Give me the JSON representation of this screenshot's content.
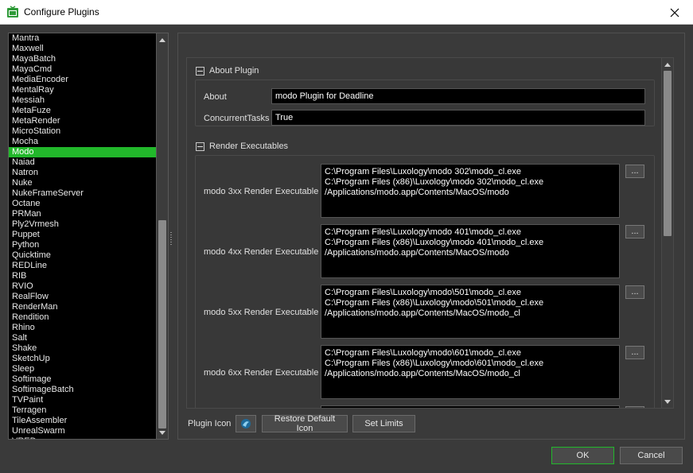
{
  "window": {
    "title": "Configure Plugins"
  },
  "colors": {
    "selection": "#22b82b",
    "list_bg": "#000000",
    "panel_bg": "#3a3a3a"
  },
  "plugins": {
    "items": [
      "Mantra",
      "Maxwell",
      "MayaBatch",
      "MayaCmd",
      "MediaEncoder",
      "MentalRay",
      "Messiah",
      "MetaFuze",
      "MetaRender",
      "MicroStation",
      "Mocha",
      "Modo",
      "Naiad",
      "Natron",
      "Nuke",
      "NukeFrameServer",
      "Octane",
      "PRMan",
      "Ply2Vrmesh",
      "Puppet",
      "Python",
      "Quicktime",
      "REDLine",
      "RIB",
      "RVIO",
      "RealFlow",
      "RenderMan",
      "Rendition",
      "Rhino",
      "Salt",
      "Shake",
      "SketchUp",
      "Sleep",
      "Softimage",
      "SoftimageBatch",
      "TVPaint",
      "Terragen",
      "TileAssembler",
      "UnrealSwarm",
      "VRED"
    ],
    "selected": "Modo"
  },
  "about_group": {
    "header": "About Plugin",
    "about_label": "About",
    "about_value": "modo Plugin for Deadline",
    "tasks_label": "ConcurrentTasks",
    "tasks_value": "True"
  },
  "exec_group": {
    "header": "Render Executables",
    "rows": [
      {
        "label": "modo 3xx Render Executable",
        "value": "C:\\Program Files\\Luxology\\modo 302\\modo_cl.exe\nC:\\Program Files (x86)\\Luxology\\modo 302\\modo_cl.exe\n/Applications/modo.app/Contents/MacOS/modo",
        "browse": "..."
      },
      {
        "label": "modo 4xx Render Executable",
        "value": "C:\\Program Files\\Luxology\\modo 401\\modo_cl.exe\nC:\\Program Files (x86)\\Luxology\\modo 401\\modo_cl.exe\n/Applications/modo.app/Contents/MacOS/modo",
        "browse": "..."
      },
      {
        "label": "modo 5xx Render Executable",
        "value": "C:\\Program Files\\Luxology\\modo\\501\\modo_cl.exe\nC:\\Program Files (x86)\\Luxology\\modo\\501\\modo_cl.exe\n/Applications/modo.app/Contents/MacOS/modo_cl",
        "browse": "..."
      },
      {
        "label": "modo 6xx Render Executable",
        "value": "C:\\Program Files\\Luxology\\modo\\601\\modo_cl.exe\nC:\\Program Files (x86)\\Luxology\\modo\\601\\modo_cl.exe\n/Applications/modo.app/Contents/MacOS/modo_cl",
        "browse": "..."
      }
    ]
  },
  "footer": {
    "plugin_icon_label": "Plugin Icon",
    "restore_label": "Restore Default Icon",
    "limits_label": "Set Limits"
  },
  "dialog": {
    "ok_label": "OK",
    "cancel_label": "Cancel"
  }
}
